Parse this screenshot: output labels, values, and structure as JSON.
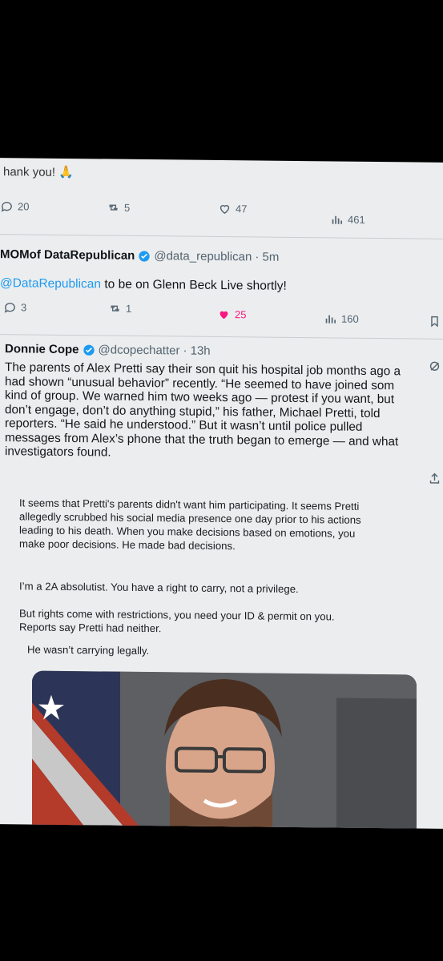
{
  "prev_tweet": {
    "text": "hank you!",
    "emoji": "🙏",
    "replies": "20",
    "retweets": "5",
    "likes": "47",
    "views": "461"
  },
  "tweet1": {
    "name": "MOMof DataRepublican",
    "handle": "@data_republican",
    "time": "· 5m",
    "mention": "@DataRepublican",
    "text": " to be on Glenn Beck Live shortly!",
    "replies": "3",
    "retweets": "1",
    "likes": "25",
    "views": "160"
  },
  "tweet2": {
    "name": "Donnie Cope",
    "handle": "@dcopechatter",
    "time": "· 13h",
    "lines": [
      "The parents of Alex Pretti say their son quit his hospital job months ago a",
      "had shown “unusual behavior” recently. “He seemed to have joined som",
      "kind of group. We warned him two weeks ago — protest if you want, but",
      "don’t engage, don’t do anything stupid,” his father, Michael Pretti, told",
      "reporters. “He said he understood.” But it wasn’t until police pulled",
      "messages from Alex’s phone that the truth began to emerge — and what",
      "investigators found."
    ],
    "para1": [
      "It seems that Pretti's parents didn't want him participating. It seems Pretti",
      "allegedly scrubbed his social media presence one day prior to his actions",
      "leading to his death. When you make decisions based on emotions, you",
      "make poor decisions. He made bad decisions."
    ],
    "para2": "I’m a 2A absolutist. You have a right to carry, not a privilege.",
    "para3": [
      "But rights come with restrictions, you need your ID & permit on you.",
      "Reports say Pretti had neither."
    ],
    "para4": "He wasn’t carrying legally."
  },
  "colors": {
    "accent": "#1d9bf0",
    "like_active": "#f91880",
    "text": "#0f1419",
    "muted": "#536471"
  }
}
